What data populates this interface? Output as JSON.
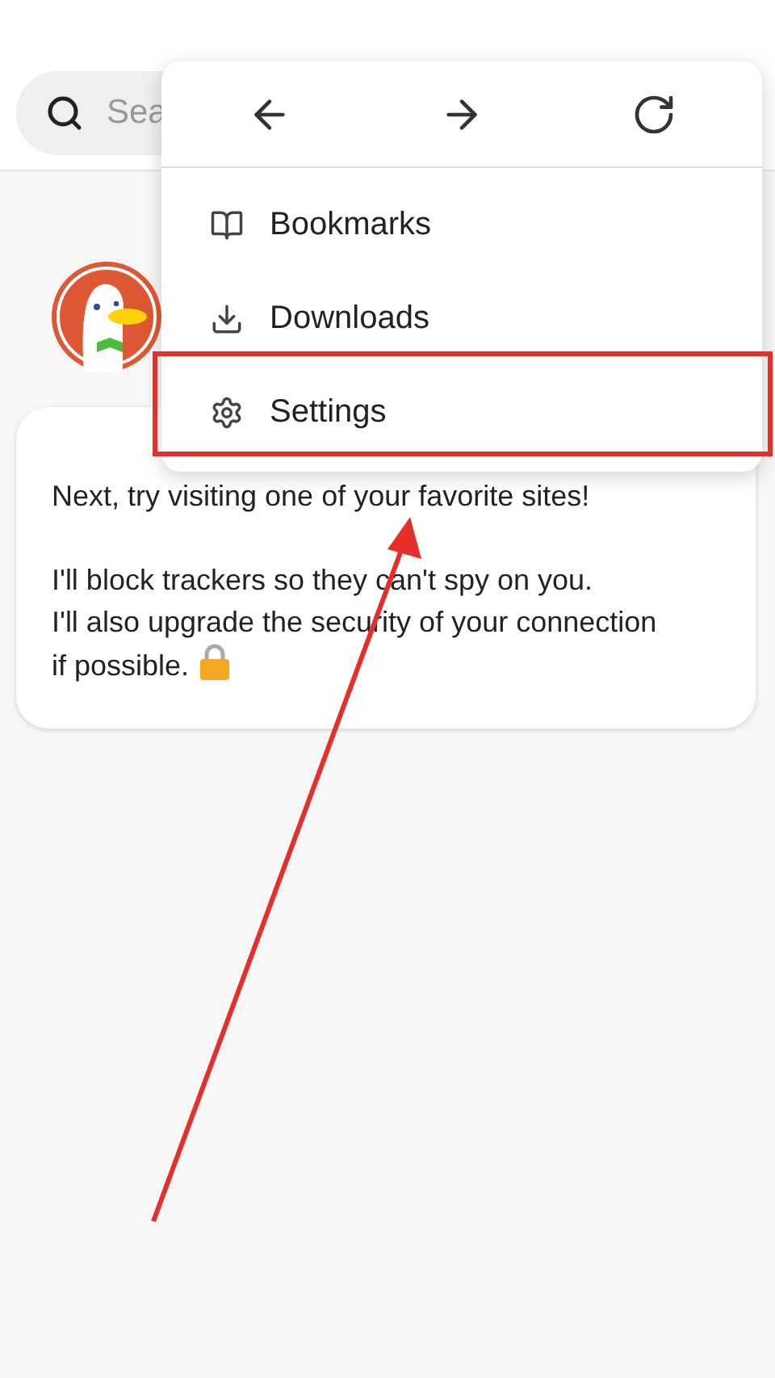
{
  "search": {
    "placeholder": "Sea"
  },
  "message": {
    "lines": [
      "Next, try visiting one of your favorite sites!",
      "I'll block trackers so they can't spy on you.",
      "I'll also upgrade the security of your connection if possible."
    ]
  },
  "menu": {
    "nav": [
      {
        "kind": "back"
      },
      {
        "kind": "forward"
      },
      {
        "kind": "reload"
      }
    ],
    "items": [
      {
        "kind": "bookmarks",
        "label": "Bookmarks"
      },
      {
        "kind": "downloads",
        "label": "Downloads"
      },
      {
        "kind": "settings",
        "label": "Settings"
      }
    ]
  }
}
